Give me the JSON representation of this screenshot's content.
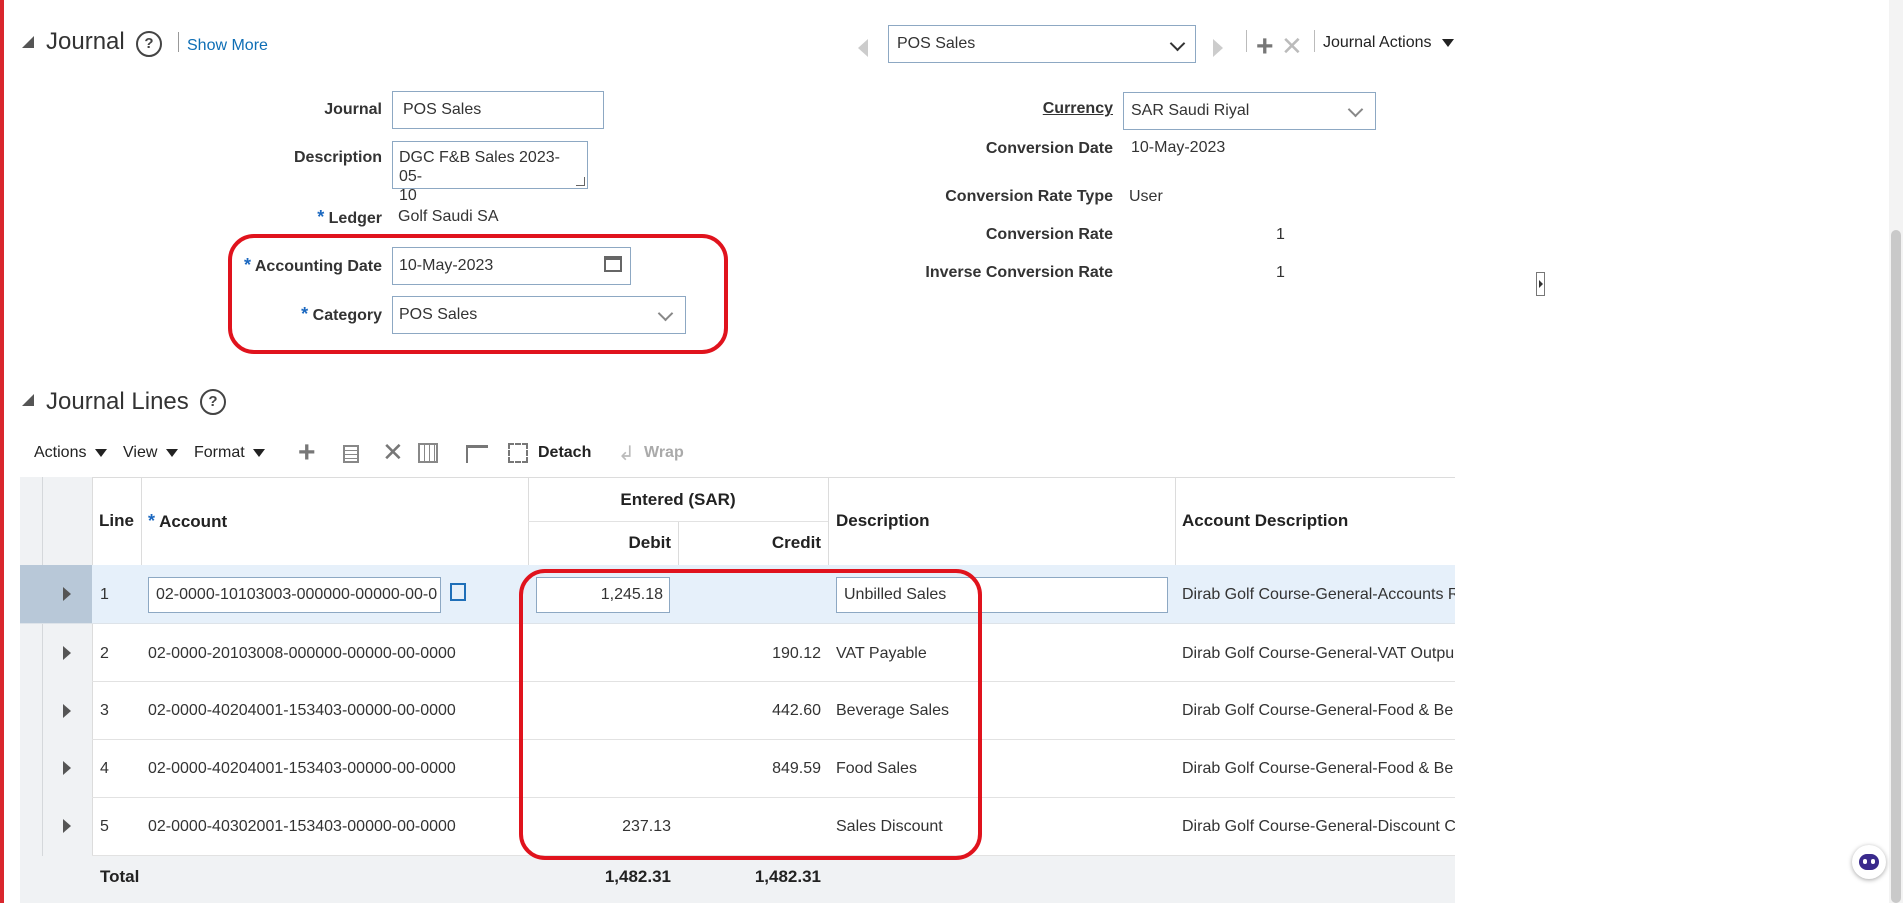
{
  "journal_section": {
    "title": "Journal",
    "show_more": "Show More",
    "nav_select_value": "POS Sales",
    "journal_actions": "Journal Actions",
    "fields": {
      "journal_label": "Journal",
      "journal_value": "POS Sales",
      "description_label": "Description",
      "description_value_line1": "DGC F&B Sales 2023-05-",
      "description_value_line2": "10",
      "ledger_label": "Ledger",
      "ledger_value": "Golf Saudi SA",
      "accounting_date_label": "Accounting Date",
      "accounting_date_value": "10-May-2023",
      "category_label": "Category",
      "category_value": "POS Sales",
      "currency_label": "Currency",
      "currency_value": "SAR Saudi Riyal",
      "conversion_date_label": "Conversion Date",
      "conversion_date_value": "10-May-2023",
      "conversion_rate_type_label": "Conversion Rate Type",
      "conversion_rate_type_value": "User",
      "conversion_rate_label": "Conversion Rate",
      "conversion_rate_value": "1",
      "inverse_rate_label": "Inverse Conversion Rate",
      "inverse_rate_value": "1"
    },
    "required_mark": "*"
  },
  "lines_section": {
    "title": "Journal Lines",
    "toolbar": {
      "actions": "Actions",
      "view": "View",
      "format": "Format",
      "detach": "Detach",
      "wrap": "Wrap"
    },
    "headers": {
      "line": "Line",
      "account": "Account",
      "entered": "Entered (SAR)",
      "debit": "Debit",
      "credit": "Credit",
      "description": "Description",
      "account_description": "Account Description"
    },
    "rows": [
      {
        "line": "1",
        "account": "02-0000-10103003-000000-00000-00-0",
        "debit": "1,245.18",
        "credit": "",
        "description": "Unbilled Sales",
        "account_description": "Dirab Golf Course-General-Accounts R"
      },
      {
        "line": "2",
        "account": "02-0000-20103008-000000-00000-00-0000",
        "debit": "",
        "credit": "190.12",
        "description": "VAT Payable",
        "account_description": "Dirab Golf Course-General-VAT Outpu"
      },
      {
        "line": "3",
        "account": "02-0000-40204001-153403-00000-00-0000",
        "debit": "",
        "credit": "442.60",
        "description": "Beverage Sales",
        "account_description": "Dirab Golf Course-General-Food & Be"
      },
      {
        "line": "4",
        "account": "02-0000-40204001-153403-00000-00-0000",
        "debit": "",
        "credit": "849.59",
        "description": "Food Sales",
        "account_description": "Dirab Golf Course-General-Food & Be"
      },
      {
        "line": "5",
        "account": "02-0000-40302001-153403-00000-00-0000",
        "debit": "237.13",
        "credit": "",
        "description": "Sales Discount",
        "account_description": "Dirab Golf Course-General-Discount C"
      }
    ],
    "total_label": "Total",
    "total_debit": "1,482.31",
    "total_credit": "1,482.31"
  },
  "colors": {
    "highlight_red": "#e0131d",
    "selected_row": "#e6f0fa",
    "link_blue": "#0e6eb5"
  }
}
